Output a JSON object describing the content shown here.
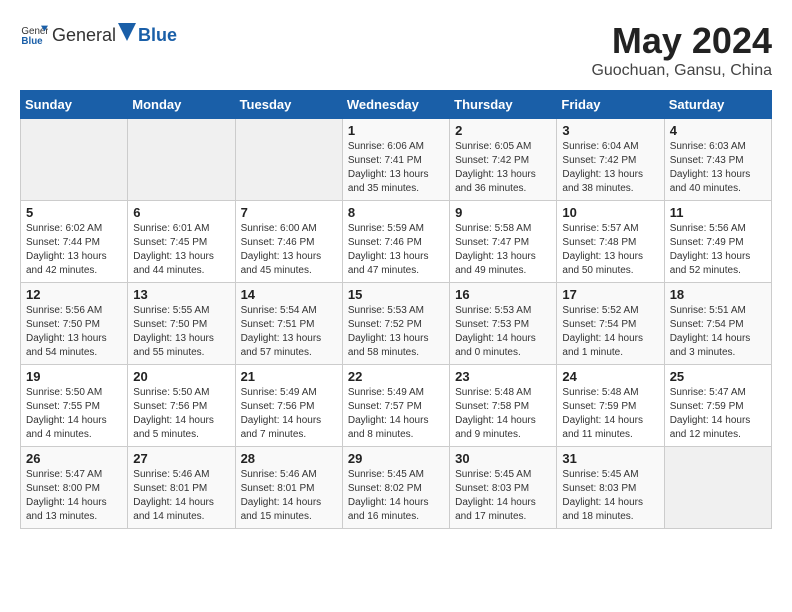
{
  "header": {
    "logo_general": "General",
    "logo_blue": "Blue",
    "title": "May 2024",
    "subtitle": "Guochuan, Gansu, China"
  },
  "weekdays": [
    "Sunday",
    "Monday",
    "Tuesday",
    "Wednesday",
    "Thursday",
    "Friday",
    "Saturday"
  ],
  "weeks": [
    [
      {
        "day": "",
        "info": ""
      },
      {
        "day": "",
        "info": ""
      },
      {
        "day": "",
        "info": ""
      },
      {
        "day": "1",
        "info": "Sunrise: 6:06 AM\nSunset: 7:41 PM\nDaylight: 13 hours\nand 35 minutes."
      },
      {
        "day": "2",
        "info": "Sunrise: 6:05 AM\nSunset: 7:42 PM\nDaylight: 13 hours\nand 36 minutes."
      },
      {
        "day": "3",
        "info": "Sunrise: 6:04 AM\nSunset: 7:42 PM\nDaylight: 13 hours\nand 38 minutes."
      },
      {
        "day": "4",
        "info": "Sunrise: 6:03 AM\nSunset: 7:43 PM\nDaylight: 13 hours\nand 40 minutes."
      }
    ],
    [
      {
        "day": "5",
        "info": "Sunrise: 6:02 AM\nSunset: 7:44 PM\nDaylight: 13 hours\nand 42 minutes."
      },
      {
        "day": "6",
        "info": "Sunrise: 6:01 AM\nSunset: 7:45 PM\nDaylight: 13 hours\nand 44 minutes."
      },
      {
        "day": "7",
        "info": "Sunrise: 6:00 AM\nSunset: 7:46 PM\nDaylight: 13 hours\nand 45 minutes."
      },
      {
        "day": "8",
        "info": "Sunrise: 5:59 AM\nSunset: 7:46 PM\nDaylight: 13 hours\nand 47 minutes."
      },
      {
        "day": "9",
        "info": "Sunrise: 5:58 AM\nSunset: 7:47 PM\nDaylight: 13 hours\nand 49 minutes."
      },
      {
        "day": "10",
        "info": "Sunrise: 5:57 AM\nSunset: 7:48 PM\nDaylight: 13 hours\nand 50 minutes."
      },
      {
        "day": "11",
        "info": "Sunrise: 5:56 AM\nSunset: 7:49 PM\nDaylight: 13 hours\nand 52 minutes."
      }
    ],
    [
      {
        "day": "12",
        "info": "Sunrise: 5:56 AM\nSunset: 7:50 PM\nDaylight: 13 hours\nand 54 minutes."
      },
      {
        "day": "13",
        "info": "Sunrise: 5:55 AM\nSunset: 7:50 PM\nDaylight: 13 hours\nand 55 minutes."
      },
      {
        "day": "14",
        "info": "Sunrise: 5:54 AM\nSunset: 7:51 PM\nDaylight: 13 hours\nand 57 minutes."
      },
      {
        "day": "15",
        "info": "Sunrise: 5:53 AM\nSunset: 7:52 PM\nDaylight: 13 hours\nand 58 minutes."
      },
      {
        "day": "16",
        "info": "Sunrise: 5:53 AM\nSunset: 7:53 PM\nDaylight: 14 hours\nand 0 minutes."
      },
      {
        "day": "17",
        "info": "Sunrise: 5:52 AM\nSunset: 7:54 PM\nDaylight: 14 hours\nand 1 minute."
      },
      {
        "day": "18",
        "info": "Sunrise: 5:51 AM\nSunset: 7:54 PM\nDaylight: 14 hours\nand 3 minutes."
      }
    ],
    [
      {
        "day": "19",
        "info": "Sunrise: 5:50 AM\nSunset: 7:55 PM\nDaylight: 14 hours\nand 4 minutes."
      },
      {
        "day": "20",
        "info": "Sunrise: 5:50 AM\nSunset: 7:56 PM\nDaylight: 14 hours\nand 5 minutes."
      },
      {
        "day": "21",
        "info": "Sunrise: 5:49 AM\nSunset: 7:56 PM\nDaylight: 14 hours\nand 7 minutes."
      },
      {
        "day": "22",
        "info": "Sunrise: 5:49 AM\nSunset: 7:57 PM\nDaylight: 14 hours\nand 8 minutes."
      },
      {
        "day": "23",
        "info": "Sunrise: 5:48 AM\nSunset: 7:58 PM\nDaylight: 14 hours\nand 9 minutes."
      },
      {
        "day": "24",
        "info": "Sunrise: 5:48 AM\nSunset: 7:59 PM\nDaylight: 14 hours\nand 11 minutes."
      },
      {
        "day": "25",
        "info": "Sunrise: 5:47 AM\nSunset: 7:59 PM\nDaylight: 14 hours\nand 12 minutes."
      }
    ],
    [
      {
        "day": "26",
        "info": "Sunrise: 5:47 AM\nSunset: 8:00 PM\nDaylight: 14 hours\nand 13 minutes."
      },
      {
        "day": "27",
        "info": "Sunrise: 5:46 AM\nSunset: 8:01 PM\nDaylight: 14 hours\nand 14 minutes."
      },
      {
        "day": "28",
        "info": "Sunrise: 5:46 AM\nSunset: 8:01 PM\nDaylight: 14 hours\nand 15 minutes."
      },
      {
        "day": "29",
        "info": "Sunrise: 5:45 AM\nSunset: 8:02 PM\nDaylight: 14 hours\nand 16 minutes."
      },
      {
        "day": "30",
        "info": "Sunrise: 5:45 AM\nSunset: 8:03 PM\nDaylight: 14 hours\nand 17 minutes."
      },
      {
        "day": "31",
        "info": "Sunrise: 5:45 AM\nSunset: 8:03 PM\nDaylight: 14 hours\nand 18 minutes."
      },
      {
        "day": "",
        "info": ""
      }
    ]
  ]
}
